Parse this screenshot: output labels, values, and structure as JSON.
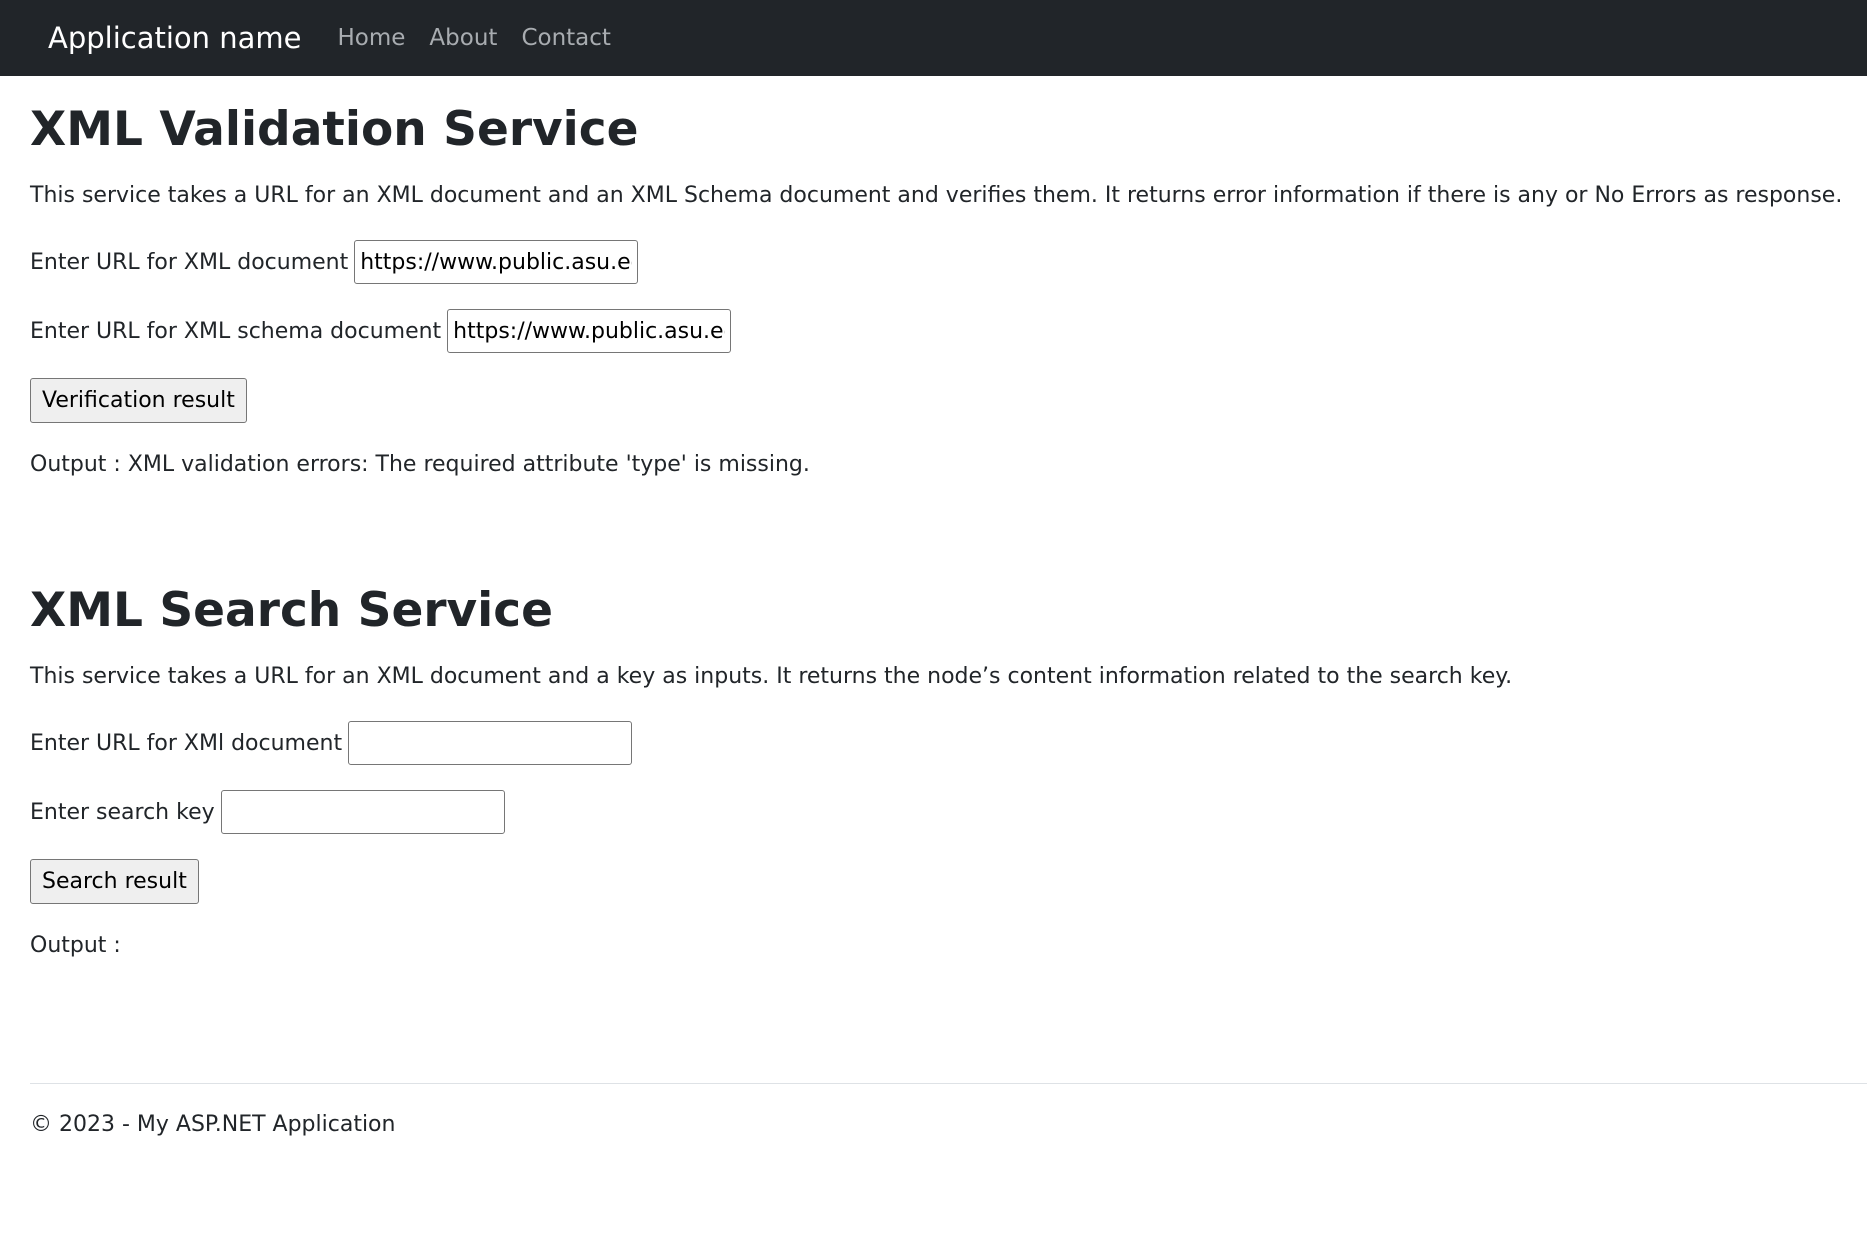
{
  "nav": {
    "brand": "Application name",
    "links": [
      "Home",
      "About",
      "Contact"
    ]
  },
  "validation": {
    "title": "XML Validation Service",
    "description": "This service takes a URL for an XML document and an XML Schema document and verifies them. It returns error information if there is any or No Errors as response.",
    "xml_label": "Enter URL for XML document",
    "xml_value": "https://www.public.asu.ed",
    "schema_label": "Enter URL for XML schema document",
    "schema_value": "https://www.public.asu.ed",
    "button_label": "Verification result",
    "output": "Output : XML validation errors: The required attribute 'type' is missing."
  },
  "search": {
    "title": "XML Search Service",
    "description": "This service takes a URL for an XML document and a key as inputs. It returns the node’s content information related to the search key.",
    "xml_label": "Enter URL for XMl document",
    "xml_value": "",
    "key_label": "Enter search key",
    "key_value": "",
    "button_label": "Search result",
    "output": "Output :"
  },
  "footer": {
    "text": "© 2023 - My ASP.NET Application"
  },
  "colors": {
    "navbar_bg": "#212529",
    "nav_link": "#a8acb0",
    "text": "#212529"
  }
}
